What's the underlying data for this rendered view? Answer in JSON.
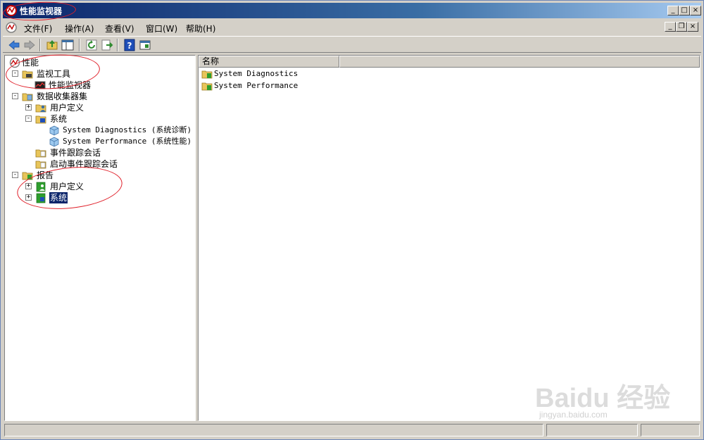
{
  "window": {
    "title": "性能监视器"
  },
  "menu": [
    "文件(F)",
    "操作(A)",
    "查看(V)",
    "窗口(W)",
    "帮助(H)"
  ],
  "window_controls": {
    "minimize": "_",
    "maximize": "□",
    "close": "×"
  },
  "mdi_controls": {
    "minimize": "_",
    "restore": "❐",
    "close": "×"
  },
  "toolbar": {
    "buttons": [
      "back-icon",
      "forward-icon",
      "up-folder-icon",
      "show-hide-tree-icon",
      "refresh-icon",
      "export-list-icon",
      "help-icon",
      "properties-icon"
    ]
  },
  "tree": {
    "root": "性能",
    "monitor_tools": "监视工具",
    "perf_monitor": "性能监视器",
    "data_collector_sets": "数据收集器集",
    "dcs_user_defined": "用户定义",
    "dcs_system": "系统",
    "system_diagnostics": "System Diagnostics (系统诊断)",
    "system_performance": "System Performance (系统性能)",
    "event_trace_sessions": "事件跟踪会话",
    "startup_event_trace_sessions": "启动事件跟踪会话",
    "reports": "报告",
    "reports_user_defined": "用户定义",
    "reports_system": "系统"
  },
  "list": {
    "column_name": "名称",
    "items": [
      "System Diagnostics",
      "System Performance"
    ]
  },
  "watermark": {
    "main": "Baidu 经验",
    "sub": "jingyan.baidu.com"
  },
  "colors": {
    "title_bar": "#0a246a",
    "selection": "#0a246a",
    "annotation": "#e0202a",
    "chrome": "#d4d0c8"
  }
}
